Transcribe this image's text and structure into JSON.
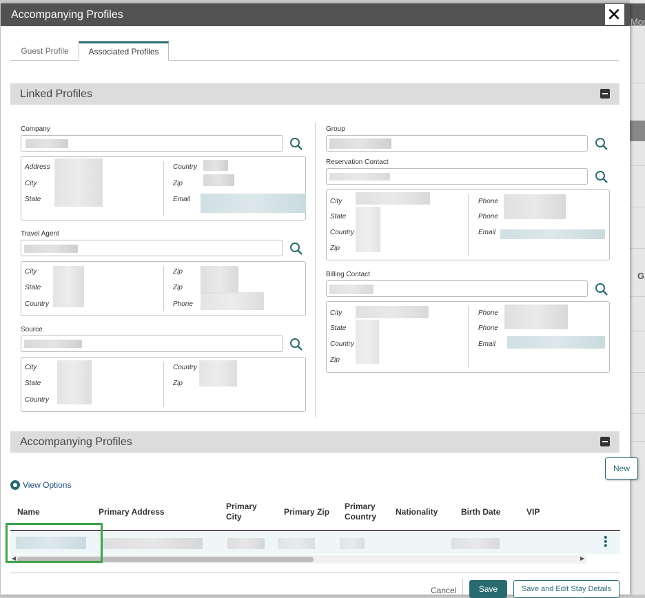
{
  "background": {
    "partial_label_top": "Mor",
    "partial_label_mid": "Gr"
  },
  "dialog": {
    "title": "Accompanying Profiles"
  },
  "tabs": [
    {
      "label": "Guest Profile",
      "active": false
    },
    {
      "label": "Associated Profiles",
      "active": true
    }
  ],
  "linked_profiles": {
    "header": "Linked Profiles",
    "company": {
      "label": "Company",
      "fields_left": [
        "Address",
        "City",
        "State"
      ],
      "fields_right": [
        "Country",
        "Zip",
        "Email"
      ]
    },
    "travel_agent": {
      "label": "Travel Agent",
      "fields_left": [
        "City",
        "State",
        "Country"
      ],
      "fields_right": [
        "Zip",
        "Zip",
        "Phone"
      ]
    },
    "source": {
      "label": "Source",
      "fields_left": [
        "City",
        "State",
        "Country"
      ],
      "fields_right": [
        "Country",
        "Zip"
      ]
    },
    "group": {
      "label": "Group"
    },
    "reservation_contact": {
      "label": "Reservation Contact",
      "fields_left": [
        "City",
        "State",
        "Country",
        "Zip"
      ],
      "fields_right": [
        "Phone",
        "Phone",
        "Email"
      ]
    },
    "billing_contact": {
      "label": "Billing Contact",
      "fields_left": [
        "City",
        "State",
        "Country",
        "Zip"
      ],
      "fields_right": [
        "Phone",
        "Phone",
        "Email"
      ]
    }
  },
  "accompanying": {
    "header": "Accompanying Profiles",
    "new_label": "New",
    "view_options_label": "View Options",
    "columns": [
      "Name",
      "Primary Address",
      "Primary City",
      "Primary Zip",
      "Primary Country",
      "Nationality",
      "Birth Date",
      "VIP"
    ]
  },
  "footer": {
    "cancel": "Cancel",
    "save": "Save",
    "save_edit": "Save and Edit Stay Details"
  },
  "colors": {
    "accent": "#2a6b72",
    "highlight": "#3ea34a",
    "titlebar": "#525252"
  }
}
